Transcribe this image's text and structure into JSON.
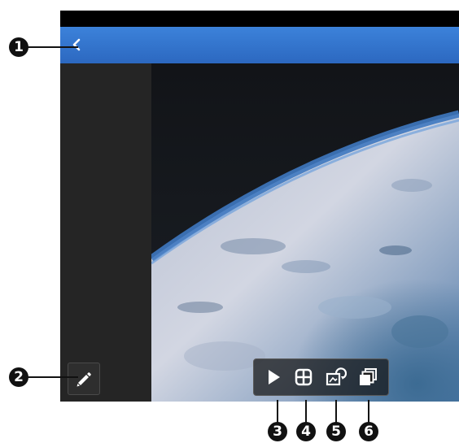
{
  "callouts": {
    "c1": "1",
    "c2": "2",
    "c3": "3",
    "c4": "4",
    "c5": "5",
    "c6": "6"
  },
  "icons": {
    "back": "chevron-left-icon",
    "edit": "pencil-icon",
    "slideshow": "play-icon",
    "grid": "grid-icon",
    "rotate": "rotate-image-icon",
    "album": "stacked-photos-icon"
  },
  "colors": {
    "topbar": "#3277cf",
    "sidebar": "#252525",
    "toolbar_bg": "#141414",
    "earth_blue": "#3e78c0"
  }
}
